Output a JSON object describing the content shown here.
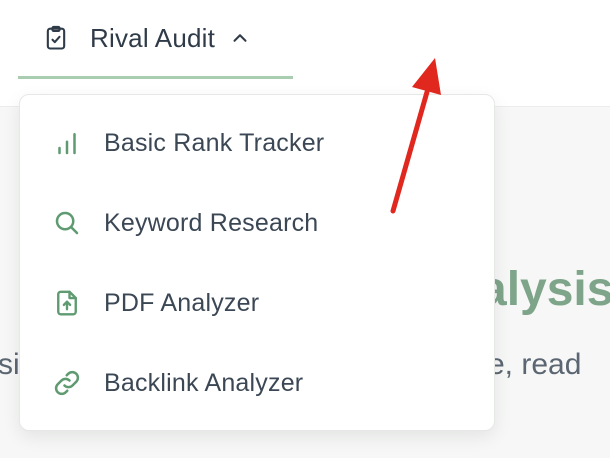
{
  "nav": {
    "tab_label": "Rival Audit",
    "tab_icon": "clipboard-check-icon",
    "expanded": true
  },
  "dropdown": {
    "items": [
      {
        "label": "Basic Rank Tracker",
        "icon": "bar-chart-icon"
      },
      {
        "label": "Keyword Research",
        "icon": "search-icon"
      },
      {
        "label": "PDF Analyzer",
        "icon": "file-upload-icon"
      },
      {
        "label": "Backlink Analyzer",
        "icon": "link-icon"
      }
    ]
  },
  "background": {
    "headline_fragment": "alysis",
    "subtext_left_fragment": "si",
    "subtext_right_fragment": "re, read"
  },
  "colors": {
    "accent": "#5f9a70",
    "headline": "#7ea58a",
    "annotation_arrow": "#e0281e"
  }
}
